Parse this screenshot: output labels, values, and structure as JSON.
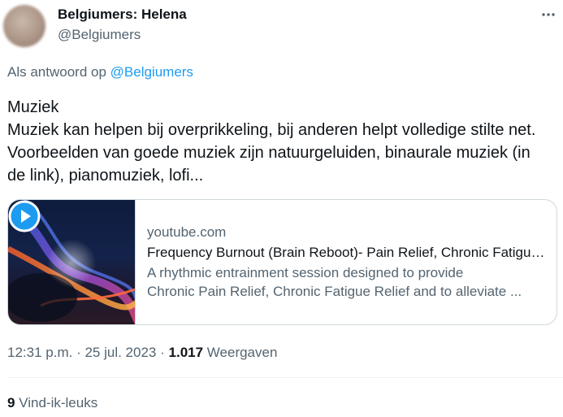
{
  "author": {
    "display_name": "Belgiumers: Helena",
    "handle": "@Belgiumers"
  },
  "icons": {
    "more": "more-horizontal-icon",
    "play": "play-icon"
  },
  "reply_context": {
    "prefix": "Als antwoord op",
    "mention": "@Belgiumers"
  },
  "tweet": {
    "lines": [
      "Muziek",
      "Muziek kan helpen bij overprikkeling, bij anderen helpt volledige stilte net. Voorbeelden van goede muziek zijn natuurgeluiden, binaurale muziek (in de link), pianomuziek, lofi..."
    ]
  },
  "link_card": {
    "domain": "youtube.com",
    "title": "Frequency Burnout (Brain Reboot)- Pain Relief, Chronic Fatigue Relief",
    "description_line1": "A rhythmic entrainment session designed to provide",
    "description_line2": "Chronic Pain Relief, Chronic Fatigue Relief and to alleviate ..."
  },
  "meta": {
    "time": "12:31 p.m.",
    "sep1": "·",
    "date": "25 jul. 2023",
    "sep2": "·",
    "views_count": "1.017",
    "views_label": "Weergaven"
  },
  "likes": {
    "count": "9",
    "label": "Vind-ik-leuks"
  },
  "colors": {
    "text_primary": "#0f1419",
    "text_secondary": "#536471",
    "accent": "#1d9bf0",
    "border": "#cfd9de"
  }
}
